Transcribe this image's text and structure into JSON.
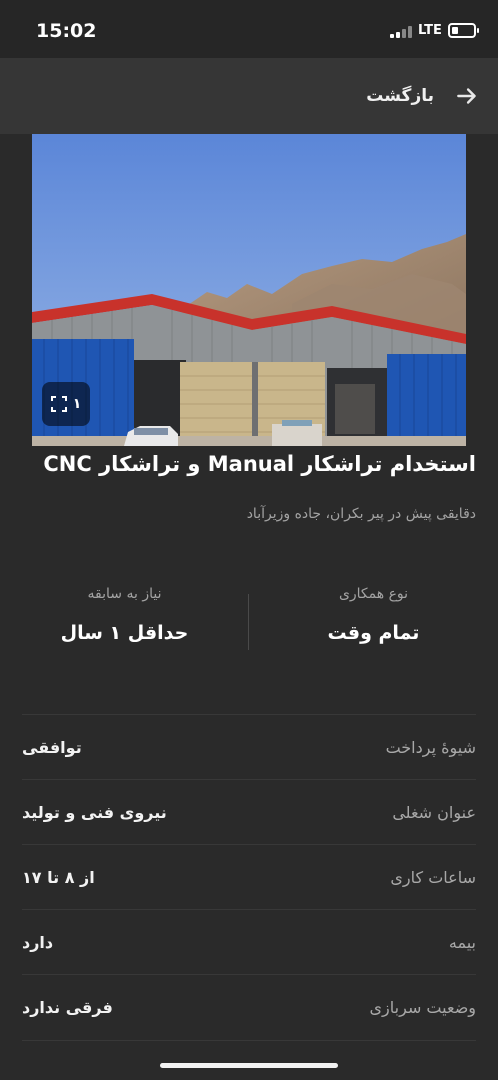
{
  "status_bar": {
    "time": "15:02",
    "network": "LTE",
    "battery_level": 0.3
  },
  "header": {
    "back_label": "بازگشت",
    "back_icon": "arrow-right-icon"
  },
  "photo": {
    "count_label": "۱",
    "expand_icon": "expand-icon"
  },
  "listing": {
    "title": "استخدام تراشکار Manual و تراشکار CNC",
    "subtitle": "دقایقی پیش در پیر بکران، جاده وزیرآباد"
  },
  "stats": [
    {
      "label": "نوع همکاری",
      "value": "تمام وقت"
    },
    {
      "label": "نیاز به سابقه",
      "value": "حداقل ۱ سال"
    }
  ],
  "details": [
    {
      "label": "شیوهٔ پرداخت",
      "value": "توافقی"
    },
    {
      "label": "عنوان شغلی",
      "value": "نیروی فنی و تولید"
    },
    {
      "label": "ساعات کاری",
      "value": "از ۸ تا ۱۷"
    },
    {
      "label": "بیمه",
      "value": "دارد"
    },
    {
      "label": "وضعیت سربازی",
      "value": "فرقی ندارد"
    }
  ],
  "colors": {
    "background": "#2a2a2a",
    "topbar": "#363636",
    "shed_blue": "#1f56b3",
    "roof_red": "#c8322b"
  }
}
